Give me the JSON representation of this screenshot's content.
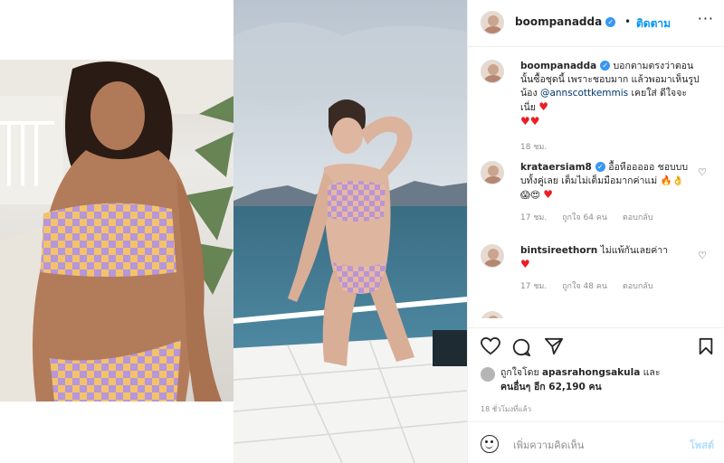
{
  "post": {
    "username": "boompanadda",
    "follow_label": "ติดตาม",
    "more_icon": "more-horizontal-icon"
  },
  "caption": {
    "username": "boompanadda",
    "text_part1": "บอกตามตรงว่าตอนนั้นซื้อชุดนี้ เพราะชอบมาก แล้วพอมาเห็นรูปน้อง",
    "mention": "@annscottkemmis",
    "text_part2": "เคยใส่ ดีใจจะเนี่ย",
    "hearts_inline": "♥",
    "hearts_line2": "♥♥",
    "time": "18 ชม."
  },
  "comments": [
    {
      "username": "krataersiam8",
      "text": "อื้อหือออออ ชอบบบบทั้งคู่เลย เต็มไม่เต็มมือมากค่าแม่",
      "emoji": "🔥👌",
      "emoji2": "😱😍",
      "hearts": "♥",
      "time": "17 ชม.",
      "likes": "ถูกใจ 64 คน",
      "reply": "ตอบกลับ"
    },
    {
      "username": "bintsireethorn",
      "text": "ไม่แพ้กันเลยค่าา",
      "hearts": "♥",
      "time": "17 ชม.",
      "likes": "ถูกใจ 48 คน",
      "reply": "ตอบกลับ"
    }
  ],
  "likes": {
    "prefix": "ถูกใจโดย",
    "user": "apasrahongsakula",
    "and": "และ",
    "others": "คนอื่นๆ อีก 62,190 คน"
  },
  "post_time": "18 ชั่วโมงที่แล้ว",
  "add_comment": {
    "placeholder": "เพิ่มความคิดเห็น",
    "post_label": "โพสต์"
  },
  "colors": {
    "accent": "#0095f6",
    "heart": "#ed1c24",
    "muted": "#8e8e8e"
  }
}
